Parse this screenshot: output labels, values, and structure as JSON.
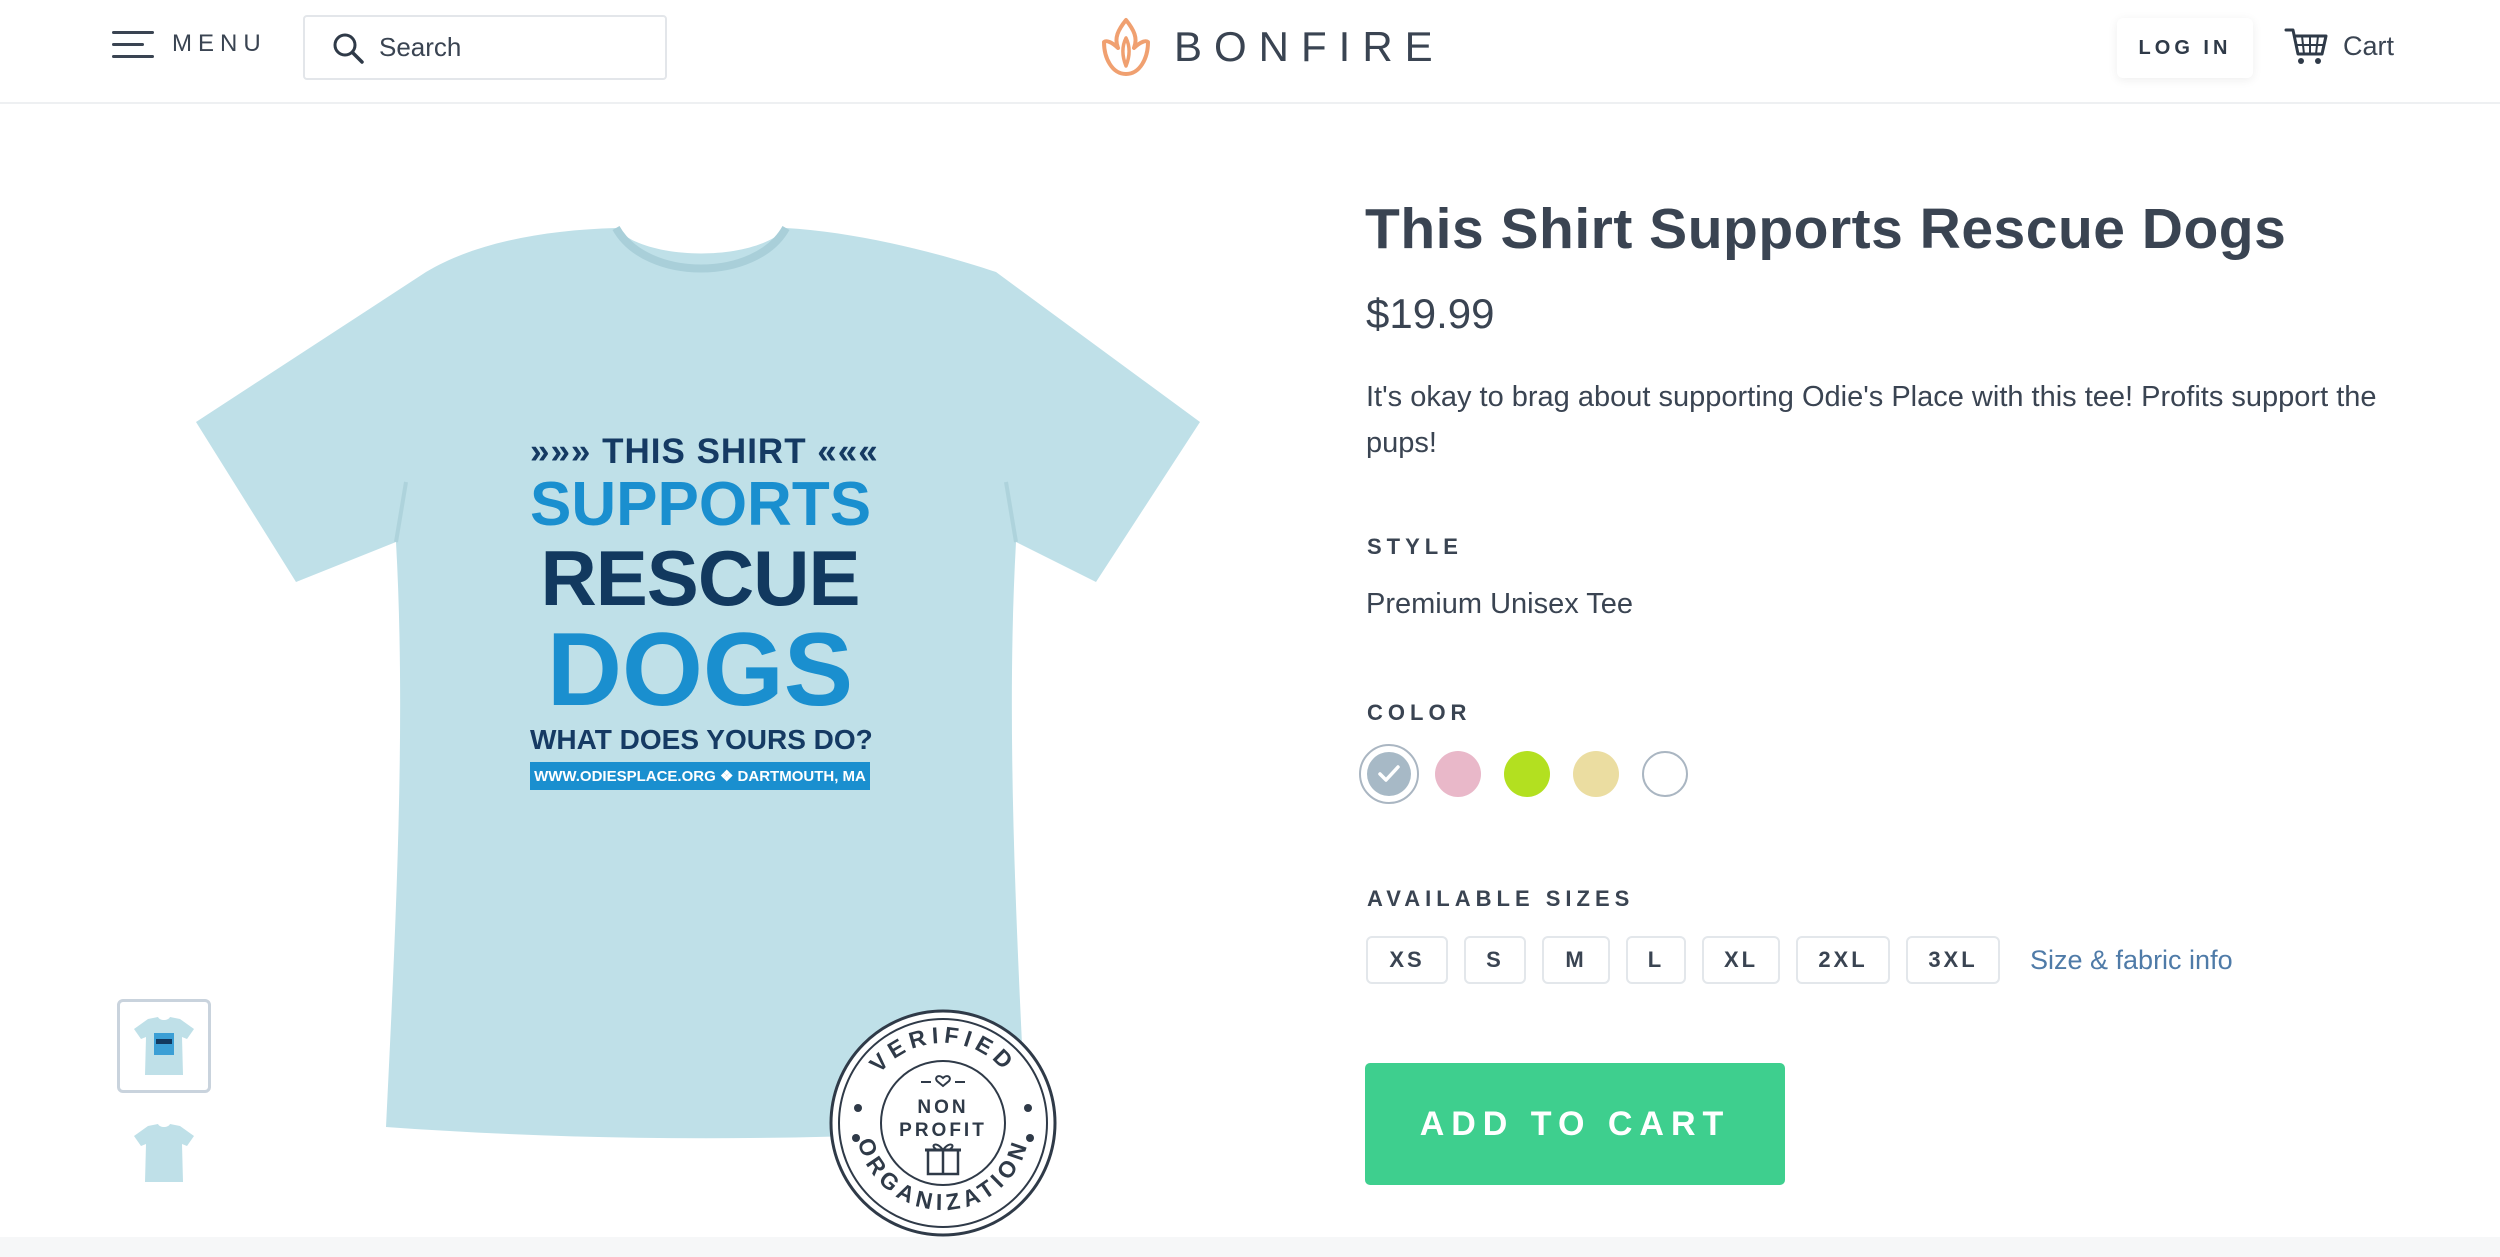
{
  "header": {
    "menu_label": "MENU",
    "search_placeholder": "Search",
    "logo_text": "BONFIRE",
    "login_label": "LOG IN",
    "cart_label": "Cart"
  },
  "product": {
    "title": "This Shirt Supports Rescue Dogs",
    "price": "$19.99",
    "description": "It's okay to brag about supporting Odie's Place with this tee! Profits support the pups!",
    "style_label": "STYLE",
    "style_value": "Premium Unisex Tee",
    "color_label": "COLOR",
    "colors": [
      {
        "name": "light-blue",
        "hex": "#a7b9c6",
        "selected": true
      },
      {
        "name": "pink",
        "hex": "#e9b8c9",
        "selected": false
      },
      {
        "name": "lime",
        "hex": "#b3e020",
        "selected": false
      },
      {
        "name": "cream",
        "hex": "#ebdda1",
        "selected": false
      },
      {
        "name": "white",
        "hex": "#ffffff",
        "selected": false
      }
    ],
    "sizes_label": "AVAILABLE SIZES",
    "sizes": [
      "XS",
      "S",
      "M",
      "L",
      "XL",
      "2XL",
      "3XL"
    ],
    "size_info_label": "Size & fabric info",
    "add_to_cart_label": "ADD TO CART"
  },
  "shirt_design": {
    "line1": "»»» THIS SHIRT «««",
    "line2": "SUPPORTS",
    "line3": "RESCUE",
    "line4": "DOGS",
    "line5": "WHAT DOES YOURS DO?",
    "line6": "WWW.ODIESPLACE.ORG ❖ DARTMOUTH, MA"
  },
  "badge": {
    "arc_top": "VERIFIED",
    "center_top": "NON",
    "center_bottom": "PROFIT",
    "arc_bottom": "ORGANIZATION"
  },
  "colors": {
    "accent_green": "#3ecf8e",
    "text_dark": "#3a4452",
    "link_blue": "#4f7ba8",
    "logo_orange": "#f0a070",
    "shirt_blue": "#bfe0e8"
  }
}
